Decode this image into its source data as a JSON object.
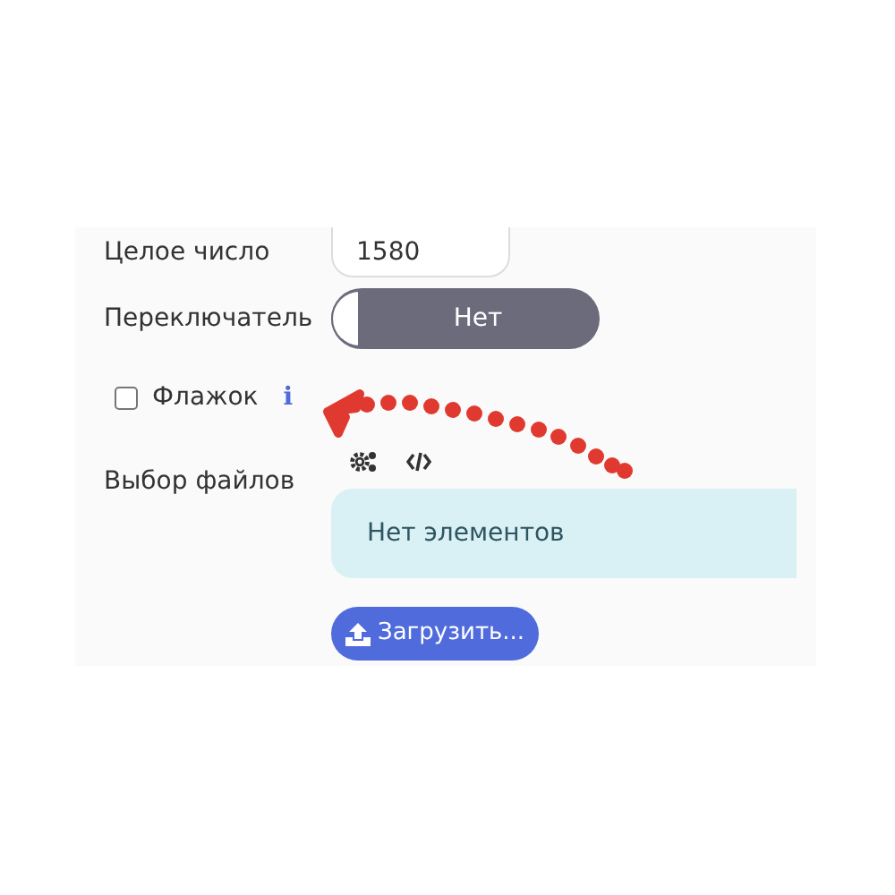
{
  "form": {
    "rows": [
      {
        "kind": "number",
        "label": "Целое число",
        "value": "1580"
      },
      {
        "kind": "toggle",
        "label": "Переключатель",
        "on": false,
        "text": "Нет"
      },
      {
        "kind": "checkbox",
        "label": "Флажок",
        "checked": false,
        "info": "i"
      },
      {
        "kind": "files",
        "label": "Выбор файлов",
        "empty_text": "Нет элементов",
        "button": "Загрузить..."
      }
    ]
  }
}
